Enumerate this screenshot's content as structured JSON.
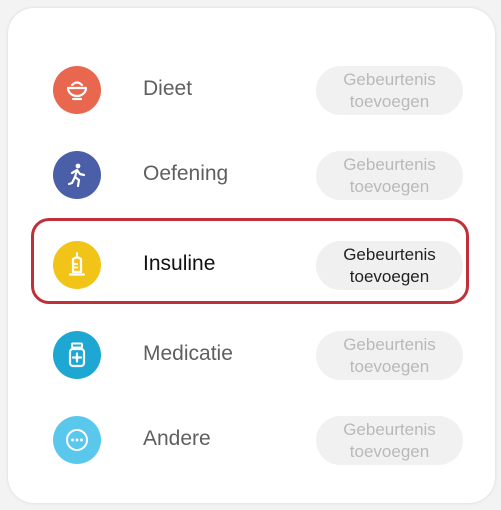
{
  "events": [
    {
      "label": "Dieet",
      "button_line1": "Gebeurtenis",
      "button_line2": "toevoegen",
      "icon": "bowl-icon",
      "color": "#e8674e",
      "selected": false
    },
    {
      "label": "Oefening",
      "button_line1": "Gebeurtenis",
      "button_line2": "toevoegen",
      "icon": "running-icon",
      "color": "#4a5fa8",
      "selected": false
    },
    {
      "label": "Insuline",
      "button_line1": "Gebeurtenis",
      "button_line2": "toevoegen",
      "icon": "syringe-icon",
      "color": "#f2c418",
      "selected": true
    },
    {
      "label": "Medicatie",
      "button_line1": "Gebeurtenis",
      "button_line2": "toevoegen",
      "icon": "pill-bottle-icon",
      "color": "#1ea7d3",
      "selected": false
    },
    {
      "label": "Andere",
      "button_line1": "Gebeurtenis",
      "button_line2": "toevoegen",
      "icon": "more-icon",
      "color": "#5ac8ec",
      "selected": false
    }
  ],
  "highlight_color": "#c0303a"
}
